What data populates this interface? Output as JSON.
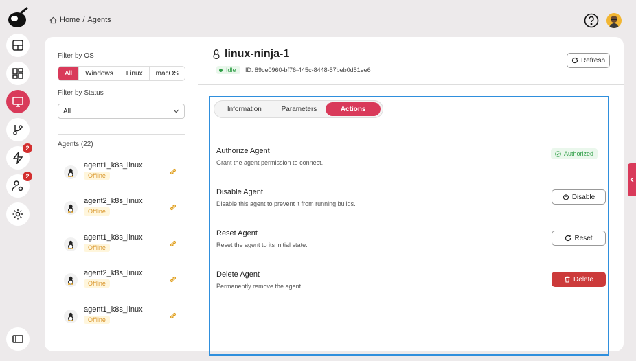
{
  "colors": {
    "accent": "#d93a5a",
    "success": "#2e9e46",
    "warning": "#d9962b",
    "danger": "#cc3a3a",
    "highlight": "#2f8fdd"
  },
  "rail": {
    "badges": {
      "events": "2",
      "users": "2"
    }
  },
  "breadcrumb": {
    "home": "Home",
    "sep": "/",
    "current": "Agents"
  },
  "filters": {
    "os_label": "Filter by OS",
    "os_options": [
      "All",
      "Windows",
      "Linux",
      "macOS"
    ],
    "os_selected": "All",
    "status_label": "Filter by Status",
    "status_value": "All"
  },
  "agents": {
    "count_label": "Agents (22)",
    "items": [
      {
        "name": "agent1_k8s_linux",
        "status": "Offline"
      },
      {
        "name": "agent2_k8s_linux",
        "status": "Offline"
      },
      {
        "name": "agent1_k8s_linux",
        "status": "Offline"
      },
      {
        "name": "agent2_k8s_linux",
        "status": "Offline"
      },
      {
        "name": "agent1_k8s_linux",
        "status": "Offline"
      }
    ]
  },
  "detail": {
    "title": "linux-ninja-1",
    "status": "Idle",
    "id_text": "ID: 89ce0960-bf76-445c-8448-57beb0d51ee6",
    "refresh_label": "Refresh",
    "tabs": [
      "Information",
      "Parameters",
      "Actions"
    ],
    "active_tab": "Actions",
    "actions": [
      {
        "title": "Authorize Agent",
        "desc": "Grant the agent permission to connect.",
        "control": "Authorized"
      },
      {
        "title": "Disable Agent",
        "desc": "Disable this agent to prevent it from running builds.",
        "control": "Disable"
      },
      {
        "title": "Reset Agent",
        "desc": "Reset the agent to its initial state.",
        "control": "Reset"
      },
      {
        "title": "Delete Agent",
        "desc": "Permanently remove the agent.",
        "control": "Delete"
      }
    ]
  }
}
